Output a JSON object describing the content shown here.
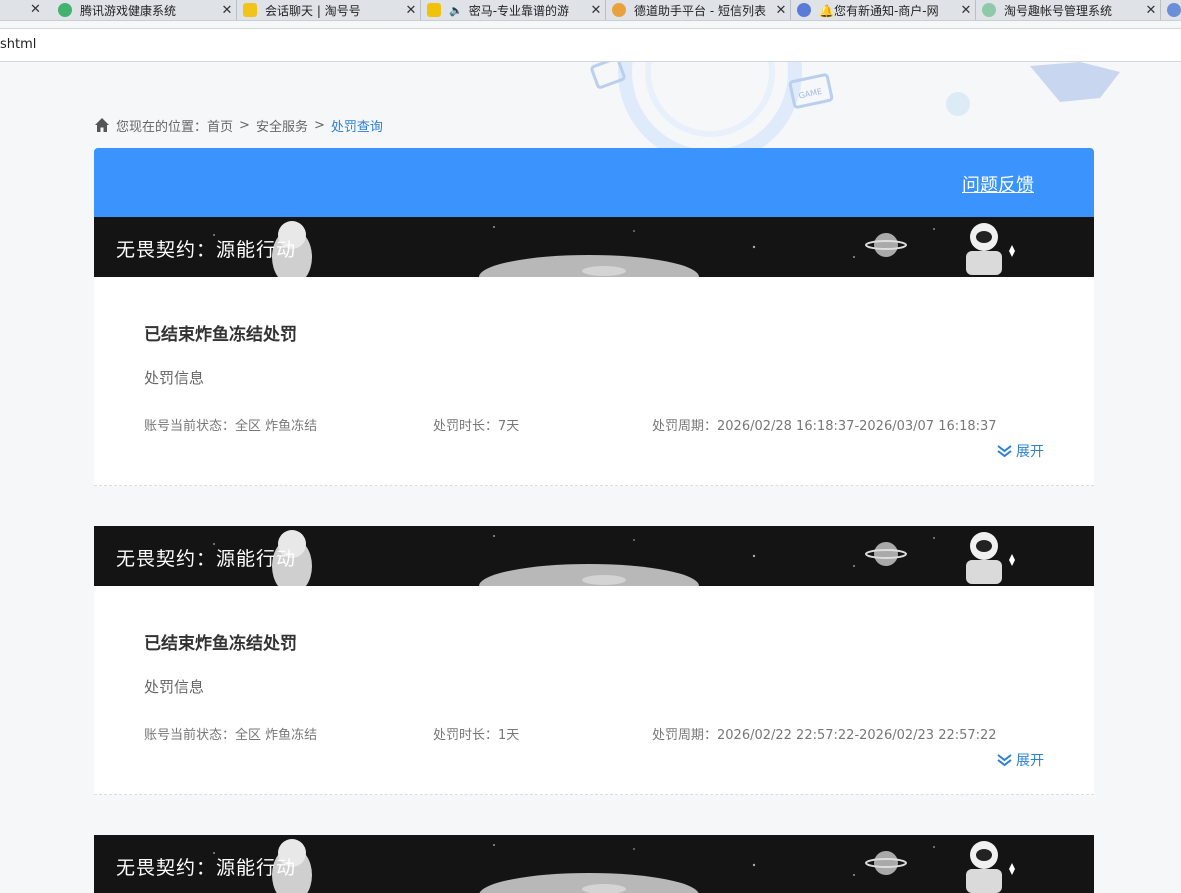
{
  "browser": {
    "first_close": "✕",
    "tabs": [
      {
        "title": "腾讯游戏健康系统",
        "fav_color": "#43b26f"
      },
      {
        "title": "会话聊天 | 淘号号",
        "fav_color": "#f2c31b"
      },
      {
        "title": "密马-专业靠谱的游",
        "fav_color": "#f0c20c",
        "speaker": true
      },
      {
        "title": "德道助手平台 - 短信列表",
        "fav_color": "#e9a23b"
      },
      {
        "title": "🔔您有新通知-商户-网",
        "fav_color": "#5b7bd8"
      },
      {
        "title": "淘号趣帐号管理系统",
        "fav_color": "#8fc9a9"
      }
    ],
    "close_glyph": "✕",
    "url": "shtml"
  },
  "breadcrumb": {
    "prefix": "您现在的位置：",
    "items": [
      "首页",
      "安全服务"
    ],
    "separator": ">",
    "current": "处罚查询"
  },
  "header": {
    "feedback": "问题反馈"
  },
  "records": [
    {
      "banner": "无畏契约：源能行动",
      "title": "已结束炸鱼冻结处罚",
      "section": "处罚信息",
      "status": "账号当前状态：全区 炸鱼冻结",
      "duration": "处罚时长：7天",
      "period": "处罚周期：2026/02/28 16:18:37-2026/03/07 16:18:37",
      "expand": "展开"
    },
    {
      "banner": "无畏契约：源能行动",
      "title": "已结束炸鱼冻结处罚",
      "section": "处罚信息",
      "status": "账号当前状态：全区 炸鱼冻结",
      "duration": "处罚时长：1天",
      "period": "处罚周期：2026/02/22 22:57:22-2026/02/23 22:57:22",
      "expand": "展开"
    },
    {
      "banner": "无畏契约：源能行动"
    }
  ]
}
